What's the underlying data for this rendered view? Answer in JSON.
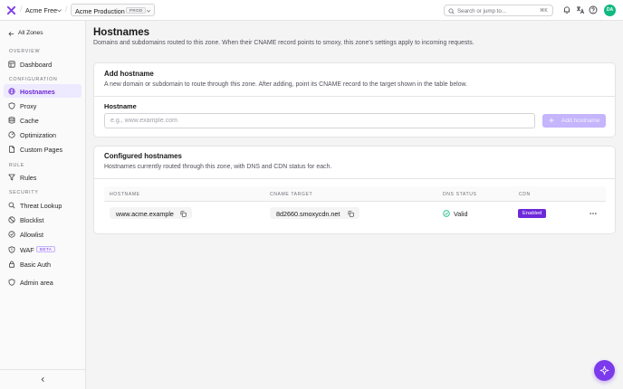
{
  "colors": {
    "brand": "#7c3aed",
    "active_bg": "#ede9fe",
    "success": "#10b981",
    "badge_enabled": "#6d28d9"
  },
  "topbar": {
    "org_name": "Acme Free",
    "zone_name": "Acme Production",
    "zone_badge": "PROD",
    "search_placeholder": "Search or jump to...",
    "search_shortcut": "⌘K",
    "avatar_initials": "DA",
    "icons": [
      "bell-icon",
      "translate-icon",
      "help-icon"
    ]
  },
  "sidebar": {
    "back_label": "All Zones",
    "sections": [
      {
        "label": "OVERVIEW",
        "items": [
          {
            "label": "Dashboard",
            "icon": "dashboard-icon"
          }
        ]
      },
      {
        "label": "CONFIGURATION",
        "items": [
          {
            "label": "Hostnames",
            "icon": "globe-icon",
            "active": true
          },
          {
            "label": "Proxy",
            "icon": "shield-icon"
          },
          {
            "label": "Cache",
            "icon": "database-icon"
          },
          {
            "label": "Optimization",
            "icon": "gauge-icon"
          },
          {
            "label": "Custom Pages",
            "icon": "file-icon"
          }
        ]
      },
      {
        "label": "RULE",
        "items": [
          {
            "label": "Rules",
            "icon": "filter-icon"
          }
        ]
      },
      {
        "label": "SECURITY",
        "items": [
          {
            "label": "Threat Lookup",
            "icon": "search-icon"
          },
          {
            "label": "Blocklist",
            "icon": "ban-icon"
          },
          {
            "label": "Allowlist",
            "icon": "check-circle-icon"
          },
          {
            "label": "WAF",
            "icon": "shield-alert-icon",
            "badge": "BETA"
          },
          {
            "label": "Basic Auth",
            "icon": "lock-icon"
          }
        ]
      }
    ],
    "admin_label": "Admin area"
  },
  "page": {
    "title": "Hostnames",
    "subtitle": "Domains and subdomains routed to this zone. When their CNAME record points to smoxy, this zone's settings apply to incoming requests."
  },
  "add_card": {
    "title": "Add hostname",
    "description": "A new domain or subdomain to route through this zone. After adding, point its CNAME record to the target shown in the table below.",
    "field_label": "Hostname",
    "input_placeholder": "e.g., www.example.com",
    "input_value": "",
    "button_label": "Add hostname"
  },
  "configured_card": {
    "title": "Configured hostnames",
    "description": "Hostnames currently routed through this zone, with DNS and CDN status for each.",
    "columns": [
      "HOSTNAME",
      "CNAME TARGET",
      "DNS STATUS",
      "CDN"
    ],
    "rows": [
      {
        "hostname": "www.acme.example",
        "cname_target": "8d2660.smoxycdn.net",
        "dns_status": "Valid",
        "cdn": "Enabled"
      }
    ]
  }
}
